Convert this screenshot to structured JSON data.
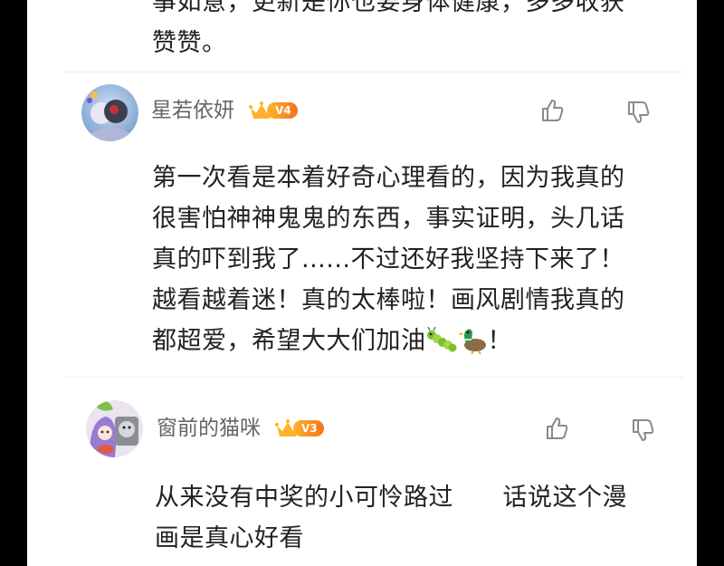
{
  "comments": [
    {
      "text_tail": "事如意，更新是你也要身体健康，多多收获\n赞赞。"
    },
    {
      "username": "星若依妍",
      "vip_level": "V4",
      "text": "第一次看是本着好奇心理看的，因为我真的\n很害怕神神鬼鬼的东西，事实证明，头几话\n真的吓到我了......不过还好我坚持下来了！\n越看越着迷！真的太棒啦！画风剧情我真的\n都超爱，希望大大们加油",
      "text_end": "！",
      "emojis": [
        "caterpillar-emoji",
        "duck-emoji"
      ]
    },
    {
      "username": "窗前的猫咪",
      "vip_level": "V3",
      "text": "从来没有中奖的小可怜路过      话说这个漫\n画是真心好看"
    }
  ],
  "colors": {
    "background": "#ffffff",
    "frame": "#000000",
    "text": "#222222",
    "username": "#666666",
    "vip_gold": "#ffb32b",
    "vip_orange": "#f5731c",
    "icon_gray": "#8a8a8a"
  },
  "icons": [
    "like-icon",
    "dislike-icon",
    "crown-icon"
  ]
}
